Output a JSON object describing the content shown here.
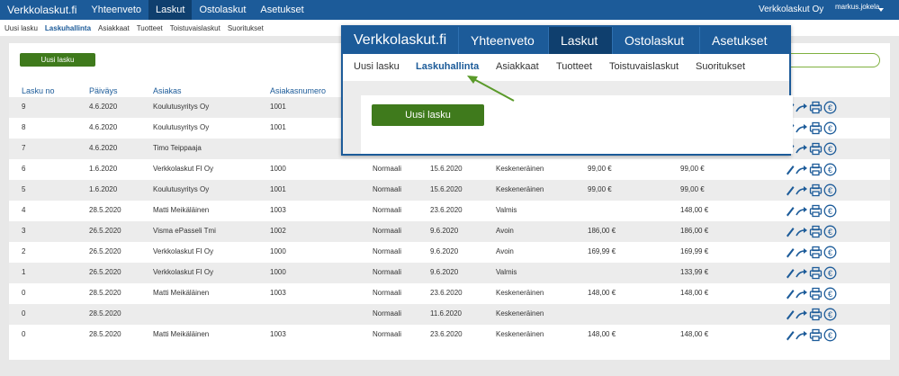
{
  "topnav": {
    "brand": "Verkkolaskut.fi",
    "items": [
      "Yhteenveto",
      "Laskut",
      "Ostolaskut",
      "Asetukset"
    ],
    "active": "Laskut",
    "company": "Verkkolaskut Oy",
    "user": "markus.jokela"
  },
  "subnav": {
    "items": [
      "Uusi lasku",
      "Laskuhallinta",
      "Asiakkaat",
      "Tuotteet",
      "Toistuvaislaskut",
      "Suoritukset"
    ],
    "active": "Laskuhallinta"
  },
  "actions": {
    "new_invoice": "Uusi lasku"
  },
  "table": {
    "headers": [
      "Lasku no",
      "Päiväys",
      "Asiakas",
      "Asiakasnumero"
    ],
    "rows": [
      [
        "9",
        "4.6.2020",
        "Koulutusyritys Oy",
        "1001",
        "",
        "",
        "",
        "",
        ""
      ],
      [
        "8",
        "4.6.2020",
        "Koulutusyritys Oy",
        "1001",
        "",
        "",
        "",
        "",
        ""
      ],
      [
        "7",
        "4.6.2020",
        "Timo Teippaaja",
        "",
        "",
        "",
        "",
        "",
        ""
      ],
      [
        "6",
        "1.6.2020",
        "Verkkolaskut FI Oy",
        "1000",
        "Normaali",
        "15.6.2020",
        "Keskeneräinen",
        "99,00 €",
        "99,00 €"
      ],
      [
        "5",
        "1.6.2020",
        "Koulutusyritys Oy",
        "1001",
        "Normaali",
        "15.6.2020",
        "Keskeneräinen",
        "99,00 €",
        "99,00 €"
      ],
      [
        "4",
        "28.5.2020",
        "Matti Meikäläinen",
        "1003",
        "Normaali",
        "23.6.2020",
        "Valmis",
        "",
        "148,00 €"
      ],
      [
        "3",
        "26.5.2020",
        "Visma ePasseli Tmi",
        "1002",
        "Normaali",
        "9.6.2020",
        "Avoin",
        "186,00 €",
        "186,00 €"
      ],
      [
        "2",
        "26.5.2020",
        "Verkkolaskut FI Oy",
        "1000",
        "Normaali",
        "9.6.2020",
        "Avoin",
        "169,99 €",
        "169,99 €"
      ],
      [
        "1",
        "26.5.2020",
        "Verkkolaskut FI Oy",
        "1000",
        "Normaali",
        "9.6.2020",
        "Valmis",
        "",
        "133,99 €"
      ],
      [
        "0",
        "28.5.2020",
        "Matti Meikäläinen",
        "1003",
        "Normaali",
        "23.6.2020",
        "Keskeneräinen",
        "148,00 €",
        "148,00 €"
      ],
      [
        "0",
        "28.5.2020",
        "",
        "",
        "Normaali",
        "11.6.2020",
        "Keskeneräinen",
        "",
        ""
      ],
      [
        "0",
        "28.5.2020",
        "Matti Meikäläinen",
        "1003",
        "Normaali",
        "23.6.2020",
        "Keskeneräinen",
        "148,00 €",
        "148,00 €"
      ]
    ]
  },
  "zoom_overlay": {
    "brand": "Verkkolaskut.fi",
    "nav": [
      "Yhteenveto",
      "Laskut",
      "Ostolaskut",
      "Asetukset"
    ],
    "sub": [
      "Uusi lasku",
      "Laskuhallinta",
      "Asiakkaat",
      "Tuotteet",
      "Toistuvaislaskut",
      "Suoritukset"
    ],
    "button": "Uusi lasku"
  },
  "colors": {
    "nav": "#1c5b99",
    "nav_active": "#0f3f6e",
    "button": "#3f7a1c",
    "arrow": "#5a9a2a"
  },
  "icons": [
    "pencil-icon",
    "forward-arrow-icon",
    "printer-icon",
    "euro-icon"
  ]
}
